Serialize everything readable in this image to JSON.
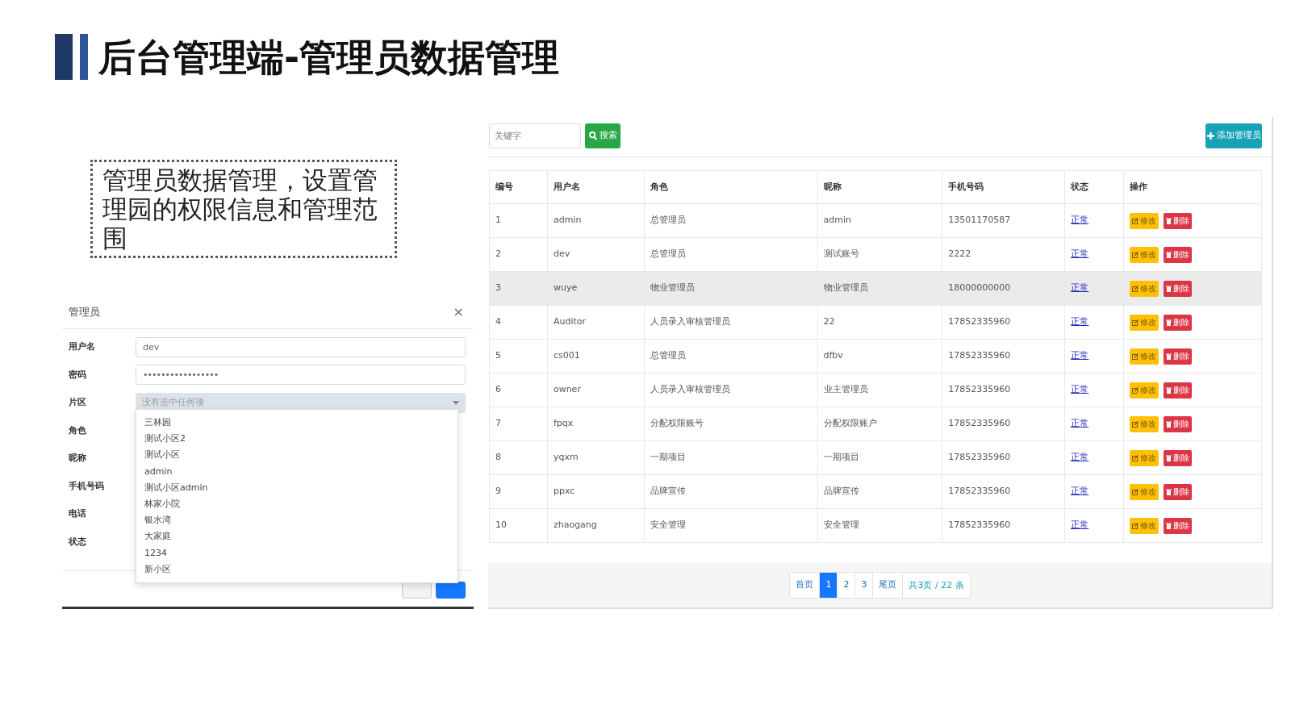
{
  "slide": {
    "title": "后台管理端-管理员数据管理",
    "note": "管理员数据管理，设置管理园的权限信息和管理范围"
  },
  "modal": {
    "title": "管理员",
    "close": "×",
    "fields": [
      {
        "label": "用户名",
        "kind": "text",
        "value": "dev"
      },
      {
        "label": "密码",
        "kind": "password",
        "value": "•••••••••••••••••"
      },
      {
        "label": "片区",
        "kind": "select",
        "placeholder": "没有选中任何项",
        "expanded": true
      },
      {
        "label": "角色",
        "kind": "covered"
      },
      {
        "label": "昵称",
        "kind": "covered"
      },
      {
        "label": "手机号码",
        "kind": "covered"
      },
      {
        "label": "电话",
        "kind": "covered"
      },
      {
        "label": "状态",
        "kind": "covered"
      }
    ],
    "dropdown_options": [
      "三林园",
      "测试小区2",
      "测试小区",
      "admin",
      "测试小区admin",
      "林家小院",
      "银水湾",
      "大家庭",
      "1234",
      "新小区"
    ]
  },
  "toolbar": {
    "search": {
      "placeholder": "关键字"
    },
    "search_button": "搜索",
    "add_button": "添加管理员"
  },
  "table": {
    "columns": [
      "编号",
      "用户名",
      "角色",
      "昵称",
      "手机号码",
      "状态",
      "操作"
    ],
    "rows": [
      {
        "cells": [
          "1",
          "admin",
          "总管理员",
          "admin",
          "13501170587"
        ],
        "status": "正常",
        "highlighted": false,
        "actions": [
          "修改",
          "删除"
        ]
      },
      {
        "cells": [
          "2",
          "dev",
          "总管理员",
          "测试账号",
          "2222"
        ],
        "status": "正常",
        "highlighted": false,
        "actions": [
          "修改",
          "删除"
        ]
      },
      {
        "cells": [
          "3",
          "wuye",
          "物业管理员",
          "物业管理员",
          "18000000000"
        ],
        "status": "正常",
        "highlighted": true,
        "actions": [
          "修改",
          "删除"
        ]
      },
      {
        "cells": [
          "4",
          "Auditor",
          "人员录入审核管理员",
          "22",
          "17852335960"
        ],
        "status": "正常",
        "highlighted": false,
        "actions": [
          "修改",
          "删除"
        ]
      },
      {
        "cells": [
          "5",
          "cs001",
          "总管理员",
          "dfbv",
          "17852335960"
        ],
        "status": "正常",
        "highlighted": false,
        "actions": [
          "修改",
          "删除"
        ]
      },
      {
        "cells": [
          "6",
          "owner",
          "人员录入审核管理员",
          "业主管理员",
          "17852335960"
        ],
        "status": "正常",
        "highlighted": false,
        "actions": [
          "修改",
          "删除"
        ]
      },
      {
        "cells": [
          "7",
          "fpqx",
          "分配权限账号",
          "分配权限账户",
          "17852335960"
        ],
        "status": "正常",
        "highlighted": false,
        "actions": [
          "修改",
          "删除"
        ]
      },
      {
        "cells": [
          "8",
          "yqxm",
          "一期项目",
          "一期项目",
          "17852335960"
        ],
        "status": "正常",
        "highlighted": false,
        "actions": [
          "修改",
          "删除"
        ]
      },
      {
        "cells": [
          "9",
          "ppxc",
          "品牌宣传",
          "品牌宣传",
          "17852335960"
        ],
        "status": "正常",
        "highlighted": false,
        "actions": [
          "修改",
          "删除"
        ]
      },
      {
        "cells": [
          "10",
          "zhaogang",
          "安全管理",
          "安全管理",
          "17852335960"
        ],
        "status": "正常",
        "highlighted": false,
        "actions": [
          "修改",
          "删除"
        ]
      }
    ]
  },
  "pagination": {
    "pages": [
      {
        "label": "首页",
        "selected": false
      },
      {
        "label": "1",
        "selected": true
      },
      {
        "label": "2",
        "selected": false
      },
      {
        "label": "3",
        "selected": false
      },
      {
        "label": "尾页",
        "selected": false
      }
    ],
    "summary": "共3页 / 22 条"
  }
}
